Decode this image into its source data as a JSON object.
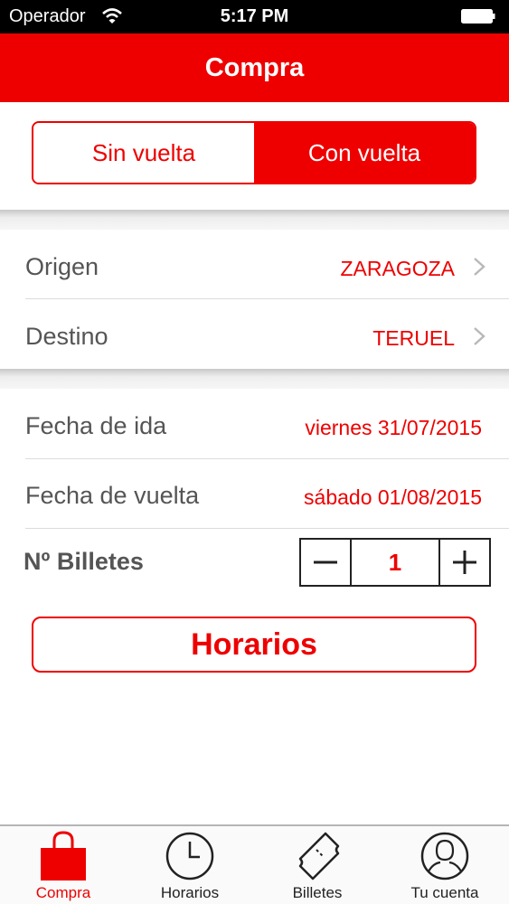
{
  "status_bar": {
    "carrier": "Operador",
    "time": "5:17 PM"
  },
  "header": {
    "title": "Compra"
  },
  "trip_type": {
    "options": [
      "Sin vuelta",
      "Con vuelta"
    ],
    "selected": "Con vuelta"
  },
  "route": {
    "origin_label": "Origen",
    "origin_value": "ZARAGOZA",
    "destination_label": "Destino",
    "destination_value": "TERUEL"
  },
  "dates": {
    "departure_label": "Fecha de ida",
    "departure_value": "viernes 31/07/2015",
    "return_label": "Fecha de vuelta",
    "return_value": "sábado 01/08/2015"
  },
  "tickets": {
    "label": "Nº Billetes",
    "count": "1"
  },
  "action_button": "Horarios",
  "tab_bar": {
    "tabs": [
      {
        "label": "Compra",
        "icon": "shopping-bag-icon",
        "active": true
      },
      {
        "label": "Horarios",
        "icon": "clock-icon",
        "active": false
      },
      {
        "label": "Billetes",
        "icon": "ticket-icon",
        "active": false
      },
      {
        "label": "Tu cuenta",
        "icon": "user-icon",
        "active": false
      }
    ]
  },
  "colors": {
    "accent": "#ee0000",
    "label_text": "#555555"
  }
}
